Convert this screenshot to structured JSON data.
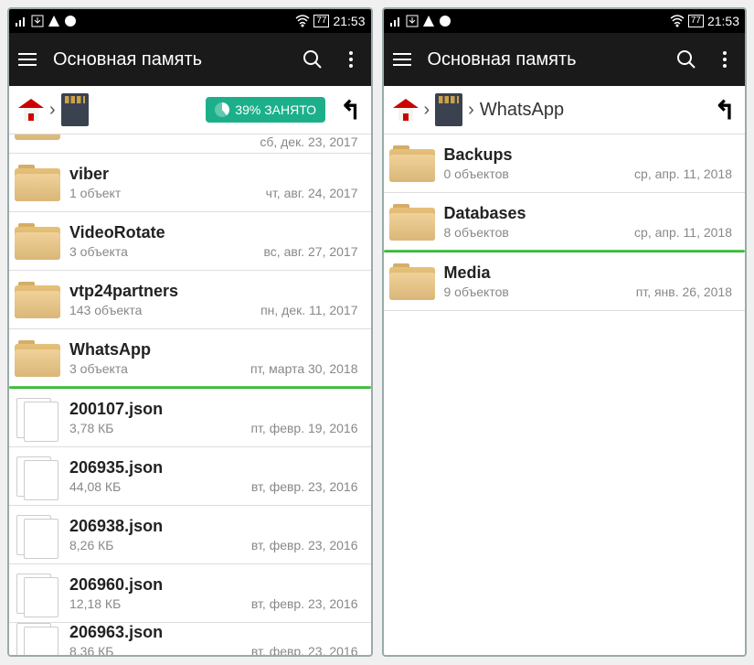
{
  "status": {
    "battery": "77",
    "time": "21:53"
  },
  "left": {
    "title": "Основная память",
    "storage_badge": "39% ЗАНЯТО",
    "partial_top": {
      "sub": "",
      "date": "сб, дек. 23, 2017"
    },
    "items": [
      {
        "name": "viber",
        "sub": "1 объект",
        "date": "чт, авг. 24, 2017",
        "type": "folder"
      },
      {
        "name": "VideoRotate",
        "sub": "3 объекта",
        "date": "вс, авг. 27, 2017",
        "type": "folder"
      },
      {
        "name": "vtp24partners",
        "sub": "143 объекта",
        "date": "пн, дек. 11, 2017",
        "type": "folder"
      },
      {
        "name": "WhatsApp",
        "sub": "3 объекта",
        "date": "пт, марта 30, 2018",
        "type": "folder",
        "highlight": true
      },
      {
        "name": "200107.json",
        "sub": "3,78 КБ",
        "date": "пт, февр. 19, 2016",
        "type": "file"
      },
      {
        "name": "206935.json",
        "sub": "44,08 КБ",
        "date": "вт, февр. 23, 2016",
        "type": "file"
      },
      {
        "name": "206938.json",
        "sub": "8,26 КБ",
        "date": "вт, февр. 23, 2016",
        "type": "file"
      },
      {
        "name": "206960.json",
        "sub": "12,18 КБ",
        "date": "вт, февр. 23, 2016",
        "type": "file"
      }
    ],
    "partial_bottom": {
      "name": "206963.json",
      "sub": "8,36 КБ",
      "date": "вт, февр. 23, 2016"
    }
  },
  "right": {
    "title": "Основная память",
    "crumb": "WhatsApp",
    "items": [
      {
        "name": "Backups",
        "sub": "0 объектов",
        "date": "ср, апр. 11, 2018",
        "type": "folder"
      },
      {
        "name": "Databases",
        "sub": "8 объектов",
        "date": "ср, апр. 11, 2018",
        "type": "folder",
        "highlight": true
      },
      {
        "name": "Media",
        "sub": "9 объектов",
        "date": "пт, янв. 26, 2018",
        "type": "folder"
      }
    ]
  }
}
